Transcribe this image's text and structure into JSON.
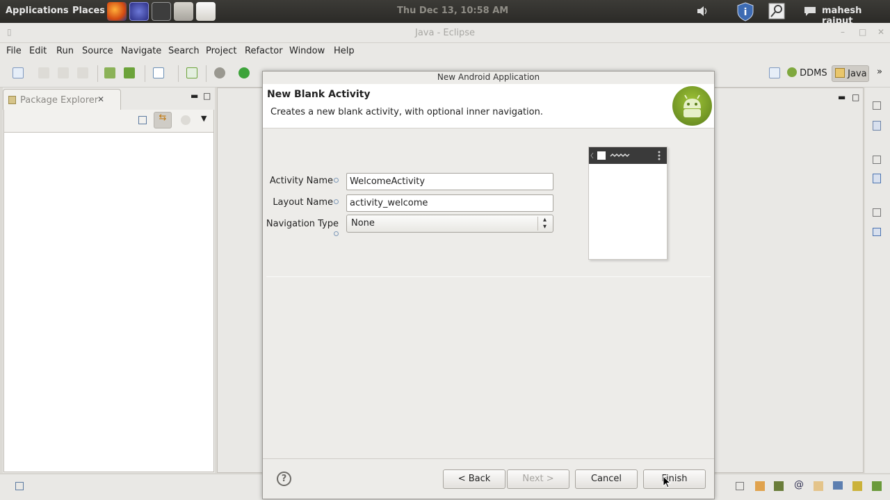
{
  "top_panel": {
    "menus": [
      "Applications",
      "Places"
    ],
    "clock": "Thu Dec 13, 10:58 AM",
    "user": "mahesh rajput",
    "launchers": [
      "firefox-icon",
      "eclipse-icon",
      "terminal-icon",
      "home-folder-icon",
      "text-editor-icon"
    ]
  },
  "window": {
    "title": "Java - Eclipse"
  },
  "menubar": [
    "File",
    "Edit",
    "Run",
    "Source",
    "Navigate",
    "Search",
    "Project",
    "Refactor",
    "Window",
    "Help"
  ],
  "perspectives": {
    "ddms": "DDMS",
    "java": "Java"
  },
  "package_explorer": {
    "title": "Package Explorer"
  },
  "dialog": {
    "window_title": "New Android Application",
    "heading": "New Blank Activity",
    "description": "Creates a new blank activity, with optional inner navigation.",
    "fields": {
      "activity_name": {
        "label": "Activity Name",
        "value": "WelcomeActivity"
      },
      "layout_name": {
        "label": "Layout Name",
        "value": "activity_welcome"
      },
      "navigation_type": {
        "label": "Navigation Type",
        "value": "None"
      }
    },
    "buttons": {
      "back": "< Back",
      "next": "Next >",
      "cancel": "Cancel",
      "finish": "Finish"
    }
  },
  "colors": {
    "panel": "#3c3b37",
    "android_green": "#9fc436",
    "dialog_bg": "#edece9"
  }
}
